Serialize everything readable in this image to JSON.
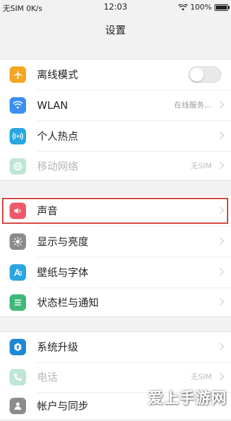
{
  "status_bar": {
    "carrier": "无SIM 0K/s",
    "time": "12:03",
    "battery": "100%"
  },
  "title": "设置",
  "groups": [
    {
      "items": [
        {
          "label": "离线模式",
          "type": "toggle",
          "on": false,
          "icon": "airplane-icon",
          "color": "#f5a623"
        },
        {
          "label": "WLAN",
          "value": "在线服务…",
          "icon": "wifi-icon",
          "color": "#3b8ff0"
        },
        {
          "label": "个人热点",
          "icon": "hotspot-icon",
          "color": "#2aa6e0"
        },
        {
          "label": "移动网络",
          "value": "无SIM",
          "icon": "globe-icon",
          "color": "#bfe6d4",
          "disabled": true
        }
      ]
    },
    {
      "items": [
        {
          "label": "声音",
          "icon": "speaker-icon",
          "color": "#ef5a6a",
          "highlighted": true
        },
        {
          "label": "显示与亮度",
          "icon": "brightness-icon",
          "color": "#8c8c8c"
        },
        {
          "label": "壁纸与字体",
          "icon": "font-icon",
          "color": "#2aa6e0"
        },
        {
          "label": "状态栏与通知",
          "icon": "list-icon",
          "color": "#3fb87a"
        }
      ]
    },
    {
      "items": [
        {
          "label": "系统升级",
          "icon": "update-icon",
          "color": "#1e88d6"
        },
        {
          "label": "电话",
          "value": "无SIM",
          "icon": "phone-icon",
          "color": "#bfe6d4",
          "disabled": true
        },
        {
          "label": "帐户与同步",
          "icon": "account-icon",
          "color": "#8c8c8c"
        }
      ]
    }
  ],
  "colors": {
    "highlight": "#d2453d",
    "background": "#f2f2f2"
  },
  "watermark": "爱上手游网"
}
